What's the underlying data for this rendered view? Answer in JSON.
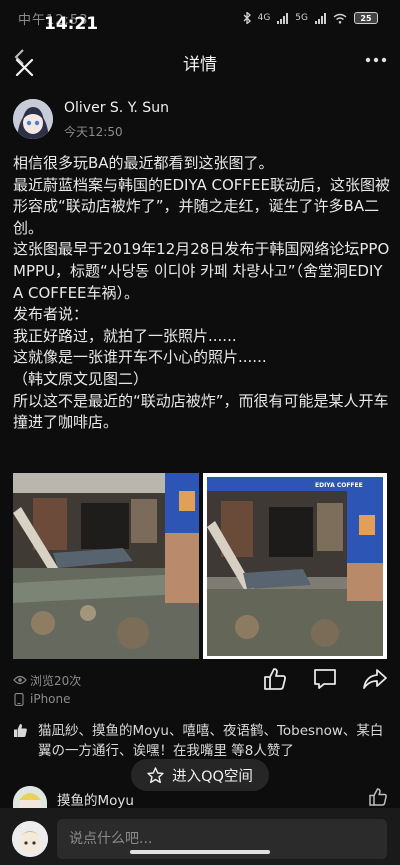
{
  "status_bar": {
    "time": "14:21",
    "ghost_text": "中午12:53",
    "network_1": "4G",
    "network_2": "5G",
    "battery": "25"
  },
  "header": {
    "title": "详情",
    "more_glyph": "•••"
  },
  "post": {
    "author": "Oliver S. Y. Sun",
    "time": "今天12:50",
    "paragraphs": [
      "相信很多玩BA的最近都看到这张图了。",
      "最近蔚蓝档案与韩国的EDIYA COFFEE联动后，这张图被形容成“联动店被炸了”，并随之走红，诞生了许多BA二创。",
      "这张图最早于2019年12月28日发布于韩国网络论坛PPOMPPU，标题“사당동 이디야 카페 차량사고”（舍堂洞EDIYA COFFEE车祸）。",
      "发布者说：",
      "我正好路过，就拍了一张照片......",
      "这就像是一张谁开车不小心的照片......",
      "（韩文原文见图二）",
      "所以这不是最近的“联动店被炸”，而很有可能是某人开车撞进了咖啡店。"
    ],
    "image_sign_text": "EDIYA COFFEE",
    "views": "浏览20次",
    "device": "iPhone"
  },
  "likes": {
    "text": "猫凪紗、摸鱼的Moyu、嘻嘻、夜语鹤、Tobesnow、某白翼の一方通行、诶嘿！在我嘴里 等8人赞了"
  },
  "qzone_button": {
    "label": "进入QQ空间"
  },
  "comment": {
    "author": "摸鱼的Moyu"
  },
  "bottom_bar": {
    "placeholder": "说点什么吧..."
  },
  "colors": {
    "background": "#0d0d0d",
    "text": "#e8e8e8",
    "muted": "#8b8b8b",
    "shop_blue": "#2d55b5"
  }
}
